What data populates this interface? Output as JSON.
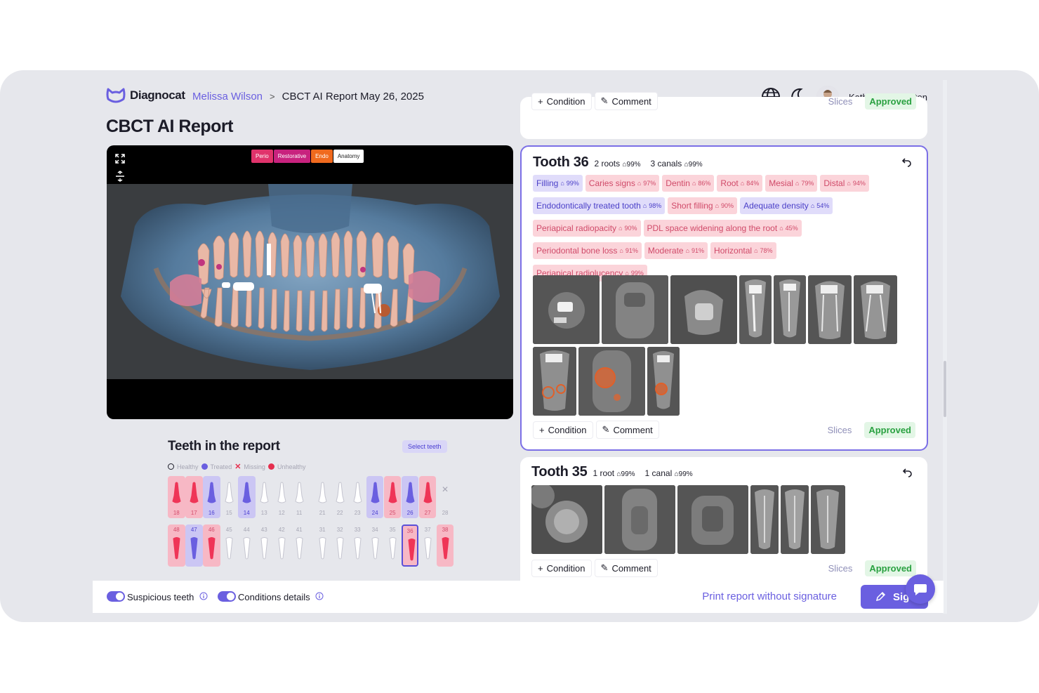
{
  "app": {
    "brand": "Diagnocat",
    "patient": "Melissa Wilson",
    "breadcrumb_sep": ">",
    "report_crumb": "CBCT AI Report May 26, 2025",
    "page_title": "CBCT AI Report",
    "user_name": "Katherine Johnston",
    "accent": "#6a5fe0"
  },
  "viewer": {
    "mode_tabs": [
      "Perio",
      "Restorative",
      "Endo",
      "Anatomy"
    ],
    "tools": [
      "expand-icon",
      "split-vertical-icon",
      "brightness-icon",
      "filter-icon",
      "invert-icon",
      "undo-icon",
      "download-icon",
      "settings-view-icon"
    ]
  },
  "teeth_panel": {
    "title": "Teeth in the report",
    "select_label": "Select teeth",
    "legend": [
      "Healthy",
      "Treated",
      "Missing",
      "Unhealthy"
    ],
    "upper": [
      {
        "num": "18",
        "status": "unhealthy"
      },
      {
        "num": "17",
        "status": "unhealthy"
      },
      {
        "num": "16",
        "status": "treated"
      },
      {
        "num": "15",
        "status": "healthy"
      },
      {
        "num": "14",
        "status": "treated"
      },
      {
        "num": "13",
        "status": "healthy"
      },
      {
        "num": "12",
        "status": "healthy"
      },
      {
        "num": "11",
        "status": "healthy"
      },
      {
        "num": "21",
        "status": "healthy"
      },
      {
        "num": "22",
        "status": "healthy"
      },
      {
        "num": "23",
        "status": "healthy"
      },
      {
        "num": "24",
        "status": "treated"
      },
      {
        "num": "25",
        "status": "unhealthy"
      },
      {
        "num": "26",
        "status": "treated"
      },
      {
        "num": "27",
        "status": "unhealthy"
      },
      {
        "num": "28",
        "status": "missing"
      }
    ],
    "lower": [
      {
        "num": "48",
        "status": "unhealthy"
      },
      {
        "num": "47",
        "status": "treated"
      },
      {
        "num": "46",
        "status": "unhealthy"
      },
      {
        "num": "45",
        "status": "healthy"
      },
      {
        "num": "44",
        "status": "healthy"
      },
      {
        "num": "43",
        "status": "healthy"
      },
      {
        "num": "42",
        "status": "healthy"
      },
      {
        "num": "41",
        "status": "healthy"
      },
      {
        "num": "31",
        "status": "healthy"
      },
      {
        "num": "32",
        "status": "healthy"
      },
      {
        "num": "33",
        "status": "healthy"
      },
      {
        "num": "34",
        "status": "healthy"
      },
      {
        "num": "35",
        "status": "healthy"
      },
      {
        "num": "36",
        "status": "unhealthy-selected"
      },
      {
        "num": "37",
        "status": "healthy"
      },
      {
        "num": "38",
        "status": "unhealthy"
      }
    ]
  },
  "card_top": {
    "condition_label": "Condition",
    "comment_label": "Comment",
    "slices_label": "Slices",
    "approved_label": "Approved"
  },
  "tooth36": {
    "title": "Tooth 36",
    "roots": "2 roots",
    "roots_pct": "99%",
    "canals": "3 canals",
    "canals_pct": "99%",
    "conditions": [
      {
        "label": "Filling",
        "pct": "99%",
        "tone": "p"
      },
      {
        "label": "Caries signs",
        "pct": "97%",
        "tone": "r"
      },
      {
        "label": "Dentin",
        "pct": "86%",
        "tone": "r"
      },
      {
        "label": "Root",
        "pct": "84%",
        "tone": "r"
      },
      {
        "label": "Mesial",
        "pct": "79%",
        "tone": "r"
      },
      {
        "label": "Distal",
        "pct": "94%",
        "tone": "r",
        "break_after": true
      },
      {
        "label": "Endodontically treated tooth",
        "pct": "98%",
        "tone": "p"
      },
      {
        "label": "Short filling",
        "pct": "90%",
        "tone": "r"
      },
      {
        "label": "Adequate density",
        "pct": "54%",
        "tone": "p",
        "break_after": true
      },
      {
        "label": "Periapical radiopacity",
        "pct": "90%",
        "tone": "r"
      },
      {
        "label": "PDL space widening along the root",
        "pct": "45%",
        "tone": "r",
        "break_after": true
      },
      {
        "label": "Periodontal bone loss",
        "pct": "91%",
        "tone": "r"
      },
      {
        "label": "Moderate",
        "pct": "91%",
        "tone": "r"
      },
      {
        "label": "Horizontal",
        "pct": "78%",
        "tone": "r",
        "break_after": true
      },
      {
        "label": "Periapical radiolucency",
        "pct": "99%",
        "tone": "r"
      }
    ],
    "condition_label": "Condition",
    "comment_label": "Comment",
    "slices_label": "Slices",
    "approved_label": "Approved"
  },
  "tooth35": {
    "title": "Tooth 35",
    "roots": "1 root",
    "roots_pct": "99%",
    "canals": "1 canal",
    "canals_pct": "99%",
    "condition_label": "Condition",
    "comment_label": "Comment",
    "slices_label": "Slices",
    "approved_label": "Approved"
  },
  "bottom": {
    "toggle1": "Suspicious teeth",
    "toggle2": "Conditions details",
    "print": "Print report without signature",
    "sign": "Sig"
  }
}
